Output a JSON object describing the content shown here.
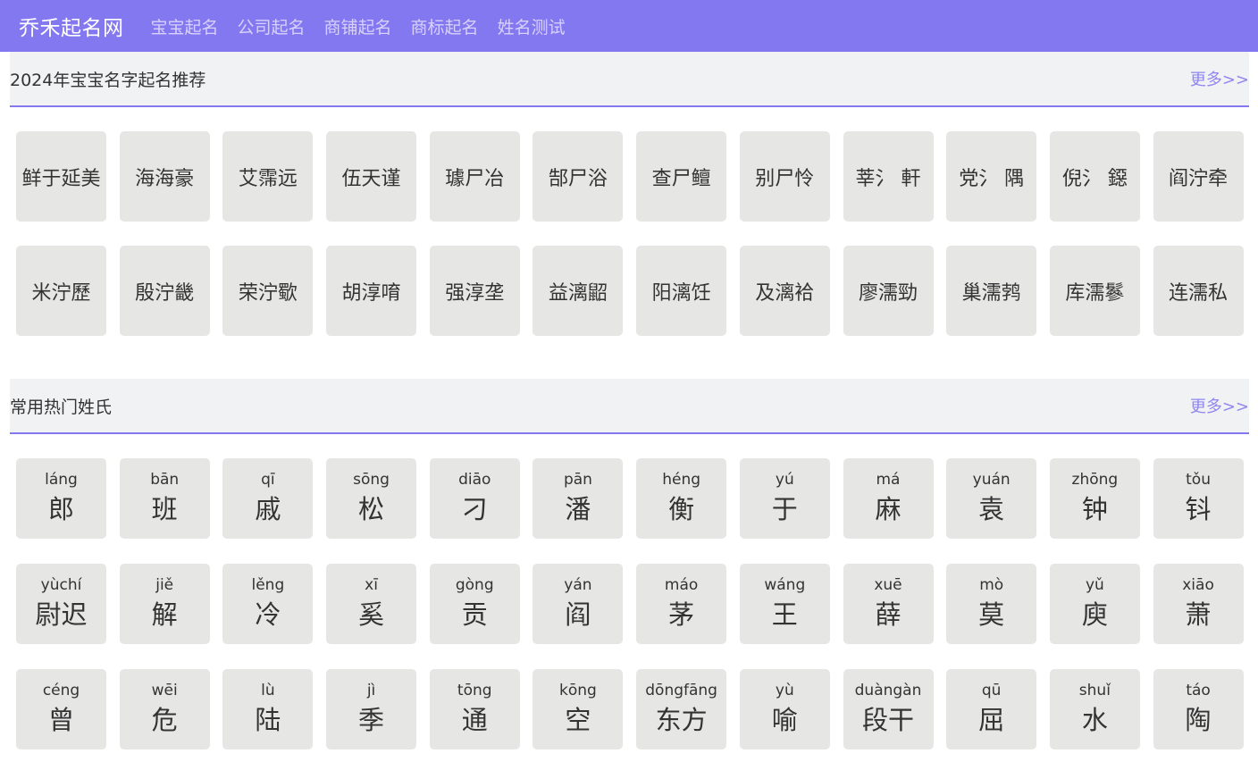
{
  "nav": {
    "brand": "乔禾起名网",
    "links": [
      "宝宝起名",
      "公司起名",
      "商铺起名",
      "商标起名",
      "姓名测试"
    ]
  },
  "names_section": {
    "title": "2024年宝宝名字起名推荐",
    "more": "更多>>",
    "names": [
      "鲜于延美",
      "海海豪",
      "艾霈远",
      "伍天谨",
      "璩尸冶",
      "郜尸浴",
      "查尸鳣",
      "别尸怜",
      "莘氵 軒",
      "党氵 隅",
      "倪氵 鐚",
      "阎泞牵",
      "米泞歷",
      "殷泞畿",
      "荣泞歜",
      "胡淳唷",
      "强淳垄",
      "益漓鼦",
      "阳漓饪",
      "及漓袷",
      "廖濡勁",
      "巢濡鹁",
      "库濡鬖",
      "连濡私"
    ]
  },
  "surnames_section": {
    "title": "常用热门姓氏",
    "more": "更多>>",
    "surnames": [
      {
        "pinyin": "láng",
        "hanzi": "郎"
      },
      {
        "pinyin": "bān",
        "hanzi": "班"
      },
      {
        "pinyin": "qī",
        "hanzi": "戚"
      },
      {
        "pinyin": "sōng",
        "hanzi": "松"
      },
      {
        "pinyin": "diāo",
        "hanzi": "刁"
      },
      {
        "pinyin": "pān",
        "hanzi": "潘"
      },
      {
        "pinyin": "héng",
        "hanzi": "衡"
      },
      {
        "pinyin": "yú",
        "hanzi": "于"
      },
      {
        "pinyin": "má",
        "hanzi": "麻"
      },
      {
        "pinyin": "yuán",
        "hanzi": "袁"
      },
      {
        "pinyin": "zhōng",
        "hanzi": "钟"
      },
      {
        "pinyin": "tǒu",
        "hanzi": "钭"
      },
      {
        "pinyin": "yùchí",
        "hanzi": "尉迟"
      },
      {
        "pinyin": "jiě",
        "hanzi": "解"
      },
      {
        "pinyin": "lěng",
        "hanzi": "冷"
      },
      {
        "pinyin": "xī",
        "hanzi": "奚"
      },
      {
        "pinyin": "gòng",
        "hanzi": "贡"
      },
      {
        "pinyin": "yán",
        "hanzi": "阎"
      },
      {
        "pinyin": "máo",
        "hanzi": "茅"
      },
      {
        "pinyin": "wáng",
        "hanzi": "王"
      },
      {
        "pinyin": "xuē",
        "hanzi": "薛"
      },
      {
        "pinyin": "mò",
        "hanzi": "莫"
      },
      {
        "pinyin": "yǔ",
        "hanzi": "庾"
      },
      {
        "pinyin": "xiāo",
        "hanzi": "萧"
      },
      {
        "pinyin": "céng",
        "hanzi": "曾"
      },
      {
        "pinyin": "wēi",
        "hanzi": "危"
      },
      {
        "pinyin": "lù",
        "hanzi": "陆"
      },
      {
        "pinyin": "jì",
        "hanzi": "季"
      },
      {
        "pinyin": "tōng",
        "hanzi": "通"
      },
      {
        "pinyin": "kōng",
        "hanzi": "空"
      },
      {
        "pinyin": "dōngfāng",
        "hanzi": "东方"
      },
      {
        "pinyin": "yù",
        "hanzi": "喻"
      },
      {
        "pinyin": "duàngàn",
        "hanzi": "段干"
      },
      {
        "pinyin": "qū",
        "hanzi": "屈"
      },
      {
        "pinyin": "shuǐ",
        "hanzi": "水"
      },
      {
        "pinyin": "táo",
        "hanzi": "陶"
      }
    ]
  }
}
